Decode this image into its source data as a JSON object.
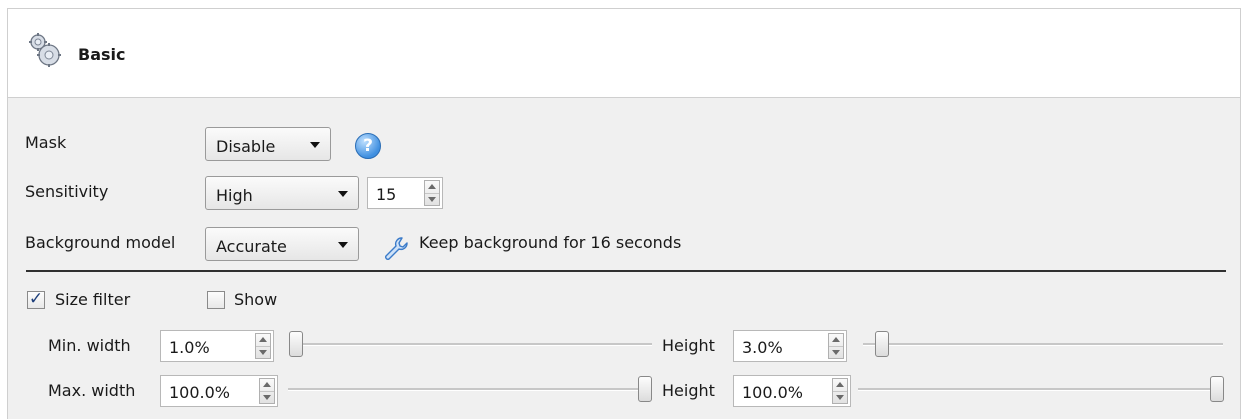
{
  "header": {
    "title": "Basic",
    "icon": "gears-icon"
  },
  "mask": {
    "label": "Mask",
    "value": "Disable",
    "help_icon": "help-icon"
  },
  "sensitivity": {
    "label": "Sensitivity",
    "value": "High",
    "number": "15"
  },
  "background_model": {
    "label": "Background model",
    "value": "Accurate",
    "icon": "wrench-icon",
    "info": "Keep background for 16 seconds"
  },
  "size_filter": {
    "checkbox_label": "Size filter",
    "checked": true,
    "show_label": "Show",
    "show_checked": false,
    "min_width_label": "Min. width",
    "min_width_value": "1.0%",
    "min_width_fraction": 0.01,
    "min_height_label": "Height",
    "min_height_value": "3.0%",
    "min_height_fraction": 0.03,
    "max_width_label": "Max. width",
    "max_width_value": "100.0%",
    "max_width_fraction": 1.0,
    "max_height_label": "Height",
    "max_height_value": "100.0%",
    "max_height_fraction": 1.0
  }
}
